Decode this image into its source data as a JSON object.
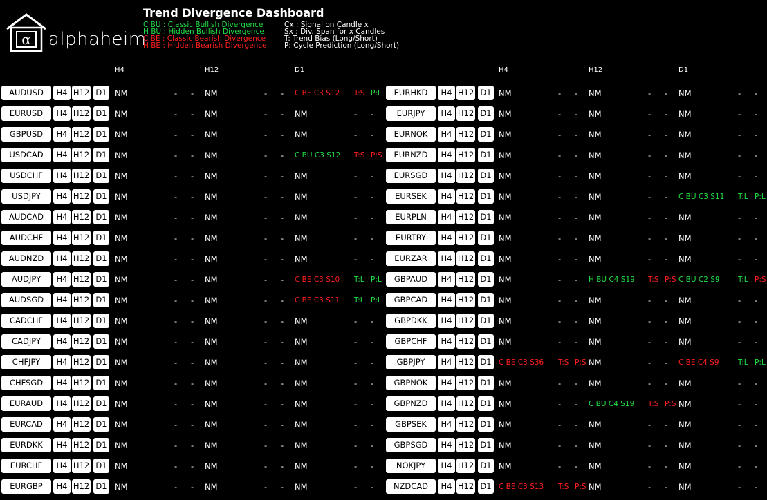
{
  "logo": {
    "brand": "alphaheim"
  },
  "title": "Trend Divergence Dashboard",
  "legend": {
    "cbu": "C BU : Classic Bullish Divergence",
    "hbu": "H BU : Hidden Bullish Divergence",
    "cbe": "C BE : Classic Bearish Divergence",
    "hbe": "H BE : Hidden Bearish Divergence",
    "cx": "Cx : Signal on Candle x",
    "sx": "Sx : Div. Span for x Candles",
    "t": "T: Trend Bias (Long/Short)",
    "p": "P: Cycle Prediction (Long/Short)"
  },
  "headers": [
    "H4",
    "H12",
    "D1"
  ],
  "tf_buttons": [
    "H4",
    "H12",
    "D1"
  ],
  "colors": {
    "green": "#22dd44",
    "red": "#ff1f1f"
  },
  "rows": [
    {
      "left": {
        "sym": "AUDUSD",
        "h4": [
          "NM",
          "-",
          "-"
        ],
        "h12": [
          "NM",
          "-",
          "-"
        ],
        "d1": [
          "C BE C3 S12",
          "T:S",
          "P:L"
        ],
        "d1c": [
          "red",
          "red",
          "green"
        ]
      },
      "right": {
        "sym": "EURHKD",
        "h4": [
          "NM",
          "-",
          "-"
        ],
        "h12": [
          "NM",
          "-",
          "-"
        ],
        "d1": [
          "NM",
          "-",
          "-"
        ]
      }
    },
    {
      "left": {
        "sym": "EURUSD",
        "h4": [
          "NM",
          "-",
          "-"
        ],
        "h12": [
          "NM",
          "-",
          "-"
        ],
        "d1": [
          "NM",
          "-",
          "-"
        ]
      },
      "right": {
        "sym": "EURJPY",
        "h4": [
          "NM",
          "-",
          "-"
        ],
        "h12": [
          "NM",
          "-",
          "-"
        ],
        "d1": [
          "NM",
          "-",
          "-"
        ]
      }
    },
    {
      "left": {
        "sym": "GBPUSD",
        "h4": [
          "NM",
          "-",
          "-"
        ],
        "h12": [
          "NM",
          "-",
          "-"
        ],
        "d1": [
          "NM",
          "-",
          "-"
        ]
      },
      "right": {
        "sym": "EURNOK",
        "h4": [
          "NM",
          "-",
          "-"
        ],
        "h12": [
          "NM",
          "-",
          "-"
        ],
        "d1": [
          "NM",
          "-",
          "-"
        ]
      }
    },
    {
      "left": {
        "sym": "USDCAD",
        "h4": [
          "NM",
          "-",
          "-"
        ],
        "h12": [
          "NM",
          "-",
          "-"
        ],
        "d1": [
          "C BU C3 S12",
          "T:S",
          "P:S"
        ],
        "d1c": [
          "green",
          "red",
          "red"
        ]
      },
      "right": {
        "sym": "EURNZD",
        "h4": [
          "NM",
          "-",
          "-"
        ],
        "h12": [
          "NM",
          "-",
          "-"
        ],
        "d1": [
          "NM",
          "-",
          "-"
        ]
      }
    },
    {
      "left": {
        "sym": "USDCHF",
        "h4": [
          "NM",
          "-",
          "-"
        ],
        "h12": [
          "NM",
          "-",
          "-"
        ],
        "d1": [
          "NM",
          "-",
          "-"
        ]
      },
      "right": {
        "sym": "EURSGD",
        "h4": [
          "NM",
          "-",
          "-"
        ],
        "h12": [
          "NM",
          "-",
          "-"
        ],
        "d1": [
          "NM",
          "-",
          "-"
        ]
      }
    },
    {
      "left": {
        "sym": "USDJPY",
        "h4": [
          "NM",
          "-",
          "-"
        ],
        "h12": [
          "NM",
          "-",
          "-"
        ],
        "d1": [
          "NM",
          "-",
          "-"
        ]
      },
      "right": {
        "sym": "EURSEK",
        "h4": [
          "NM",
          "-",
          "-"
        ],
        "h12": [
          "NM",
          "-",
          "-"
        ],
        "d1": [
          "C BU C3 S11",
          "T:L",
          "P:L"
        ],
        "d1c": [
          "green",
          "green",
          "green"
        ]
      }
    },
    {
      "left": {
        "sym": "AUDCAD",
        "h4": [
          "NM",
          "-",
          "-"
        ],
        "h12": [
          "NM",
          "-",
          "-"
        ],
        "d1": [
          "NM",
          "-",
          "-"
        ]
      },
      "right": {
        "sym": "EURPLN",
        "h4": [
          "NM",
          "-",
          "-"
        ],
        "h12": [
          "NM",
          "-",
          "-"
        ],
        "d1": [
          "NM",
          "-",
          "-"
        ]
      }
    },
    {
      "left": {
        "sym": "AUDCHF",
        "h4": [
          "NM",
          "-",
          "-"
        ],
        "h12": [
          "NM",
          "-",
          "-"
        ],
        "d1": [
          "NM",
          "-",
          "-"
        ]
      },
      "right": {
        "sym": "EURTRY",
        "h4": [
          "NM",
          "-",
          "-"
        ],
        "h12": [
          "NM",
          "-",
          "-"
        ],
        "d1": [
          "NM",
          "-",
          "-"
        ]
      }
    },
    {
      "left": {
        "sym": "AUDNZD",
        "h4": [
          "NM",
          "-",
          "-"
        ],
        "h12": [
          "NM",
          "-",
          "-"
        ],
        "d1": [
          "NM",
          "-",
          "-"
        ]
      },
      "right": {
        "sym": "EURZAR",
        "h4": [
          "NM",
          "-",
          "-"
        ],
        "h12": [
          "NM",
          "-",
          "-"
        ],
        "d1": [
          "NM",
          "-",
          "-"
        ]
      }
    },
    {
      "left": {
        "sym": "AUDJPY",
        "h4": [
          "NM",
          "-",
          "-"
        ],
        "h12": [
          "NM",
          "-",
          "-"
        ],
        "d1": [
          "C BE C3 S10",
          "T:L",
          "P:L"
        ],
        "d1c": [
          "red",
          "green",
          "green"
        ]
      },
      "right": {
        "sym": "GBPAUD",
        "h4": [
          "NM",
          "-",
          "-"
        ],
        "h12": [
          "H BU C4 S19",
          "T:S",
          "P:S"
        ],
        "h12c": [
          "green",
          "red",
          "red"
        ],
        "d1": [
          "C BU C2 S9",
          "T:L",
          "P:S"
        ],
        "d1c": [
          "green",
          "green",
          "red"
        ]
      }
    },
    {
      "left": {
        "sym": "AUDSGD",
        "h4": [
          "NM",
          "-",
          "-"
        ],
        "h12": [
          "NM",
          "-",
          "-"
        ],
        "d1": [
          "C BE C3 S11",
          "T:L",
          "P:L"
        ],
        "d1c": [
          "red",
          "green",
          "green"
        ]
      },
      "right": {
        "sym": "GBPCAD",
        "h4": [
          "NM",
          "-",
          "-"
        ],
        "h12": [
          "NM",
          "-",
          "-"
        ],
        "d1": [
          "NM",
          "-",
          "-"
        ]
      }
    },
    {
      "left": {
        "sym": "CADCHF",
        "h4": [
          "NM",
          "-",
          "-"
        ],
        "h12": [
          "NM",
          "-",
          "-"
        ],
        "d1": [
          "NM",
          "-",
          "-"
        ]
      },
      "right": {
        "sym": "GBPDKK",
        "h4": [
          "NM",
          "-",
          "-"
        ],
        "h12": [
          "NM",
          "-",
          "-"
        ],
        "d1": [
          "NM",
          "-",
          "-"
        ]
      }
    },
    {
      "left": {
        "sym": "CADJPY",
        "h4": [
          "NM",
          "-",
          "-"
        ],
        "h12": [
          "NM",
          "-",
          "-"
        ],
        "d1": [
          "NM",
          "-",
          "-"
        ]
      },
      "right": {
        "sym": "GBPCHF",
        "h4": [
          "NM",
          "-",
          "-"
        ],
        "h12": [
          "NM",
          "-",
          "-"
        ],
        "d1": [
          "NM",
          "-",
          "-"
        ]
      }
    },
    {
      "left": {
        "sym": "CHFJPY",
        "h4": [
          "NM",
          "-",
          "-"
        ],
        "h12": [
          "NM",
          "-",
          "-"
        ],
        "d1": [
          "NM",
          "-",
          "-"
        ]
      },
      "right": {
        "sym": "GBPJPY",
        "h4": [
          "C BE C3 S36",
          "T:S",
          "P:S"
        ],
        "h4c": [
          "red",
          "red",
          "red"
        ],
        "h12": [
          "NM",
          "-",
          "-"
        ],
        "d1": [
          "C BE C4 S9",
          "T:L",
          "P:L"
        ],
        "d1c": [
          "red",
          "green",
          "green"
        ]
      }
    },
    {
      "left": {
        "sym": "CHFSGD",
        "h4": [
          "NM",
          "-",
          "-"
        ],
        "h12": [
          "NM",
          "-",
          "-"
        ],
        "d1": [
          "NM",
          "-",
          "-"
        ]
      },
      "right": {
        "sym": "GBPNOK",
        "h4": [
          "NM",
          "-",
          "-"
        ],
        "h12": [
          "NM",
          "-",
          "-"
        ],
        "d1": [
          "NM",
          "-",
          "-"
        ]
      }
    },
    {
      "left": {
        "sym": "EURAUD",
        "h4": [
          "NM",
          "-",
          "-"
        ],
        "h12": [
          "NM",
          "-",
          "-"
        ],
        "d1": [
          "NM",
          "-",
          "-"
        ]
      },
      "right": {
        "sym": "GBPNZD",
        "h4": [
          "NM",
          "-",
          "-"
        ],
        "h12": [
          "C BU C4 S19",
          "T:S",
          "P:S"
        ],
        "h12c": [
          "green",
          "red",
          "red"
        ],
        "d1": [
          "NM",
          "-",
          "-"
        ]
      }
    },
    {
      "left": {
        "sym": "EURCAD",
        "h4": [
          "NM",
          "-",
          "-"
        ],
        "h12": [
          "NM",
          "-",
          "-"
        ],
        "d1": [
          "NM",
          "-",
          "-"
        ]
      },
      "right": {
        "sym": "GBPSEK",
        "h4": [
          "NM",
          "-",
          "-"
        ],
        "h12": [
          "NM",
          "-",
          "-"
        ],
        "d1": [
          "NM",
          "-",
          "-"
        ]
      }
    },
    {
      "left": {
        "sym": "EURDKK",
        "h4": [
          "NM",
          "-",
          "-"
        ],
        "h12": [
          "NM",
          "-",
          "-"
        ],
        "d1": [
          "NM",
          "-",
          "-"
        ]
      },
      "right": {
        "sym": "GBPSGD",
        "h4": [
          "NM",
          "-",
          "-"
        ],
        "h12": [
          "NM",
          "-",
          "-"
        ],
        "d1": [
          "NM",
          "-",
          "-"
        ]
      }
    },
    {
      "left": {
        "sym": "EURCHF",
        "h4": [
          "NM",
          "-",
          "-"
        ],
        "h12": [
          "NM",
          "-",
          "-"
        ],
        "d1": [
          "NM",
          "-",
          "-"
        ]
      },
      "right": {
        "sym": "NOKJPY",
        "h4": [
          "NM",
          "-",
          "-"
        ],
        "h12": [
          "NM",
          "-",
          "-"
        ],
        "d1": [
          "NM",
          "-",
          "-"
        ]
      }
    },
    {
      "left": {
        "sym": "EURGBP",
        "h4": [
          "NM",
          "-",
          "-"
        ],
        "h12": [
          "NM",
          "-",
          "-"
        ],
        "d1": [
          "NM",
          "-",
          "-"
        ]
      },
      "right": {
        "sym": "NZDCAD",
        "h4": [
          "C BE C3 S13",
          "T:S",
          "P:S"
        ],
        "h4c": [
          "red",
          "red",
          "red"
        ],
        "h12": [
          "NM",
          "-",
          "-"
        ],
        "d1": [
          "NM",
          "-",
          "-"
        ]
      }
    }
  ]
}
